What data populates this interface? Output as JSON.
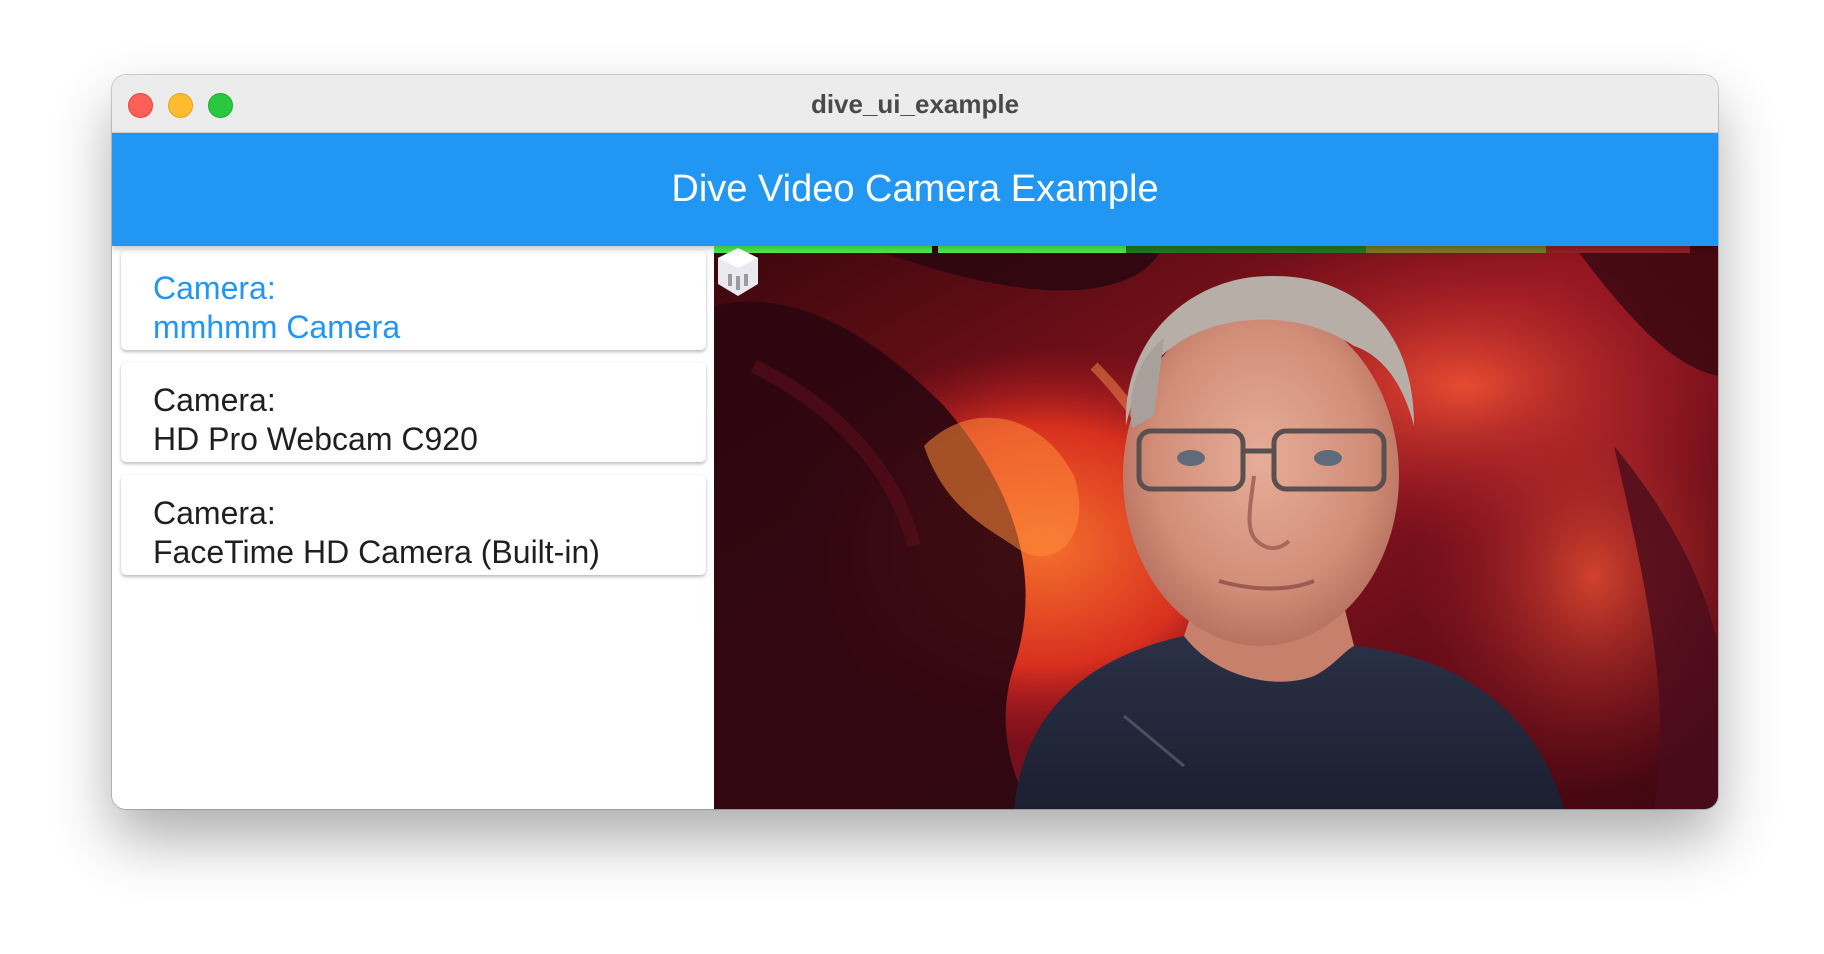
{
  "window": {
    "title": "dive_ui_example"
  },
  "appbar": {
    "title": "Dive Video Camera Example"
  },
  "cameras": [
    {
      "label": "Camera:",
      "name": "mmhmm Camera",
      "selected": true
    },
    {
      "label": "Camera:",
      "name": "HD Pro Webcam C920",
      "selected": false
    },
    {
      "label": "Camera:",
      "name": "FaceTime HD Camera (Built-in)",
      "selected": false
    }
  ],
  "colors": {
    "accent": "#2196f3",
    "meter_green_active": "#4cec4c",
    "meter_green_dim": "#207a20",
    "meter_yellow_dim": "#7d7a22",
    "meter_red_dim": "#922024"
  },
  "video": {
    "description_icon": "mmhmm-logo-icon",
    "audio_level": 0.42
  }
}
